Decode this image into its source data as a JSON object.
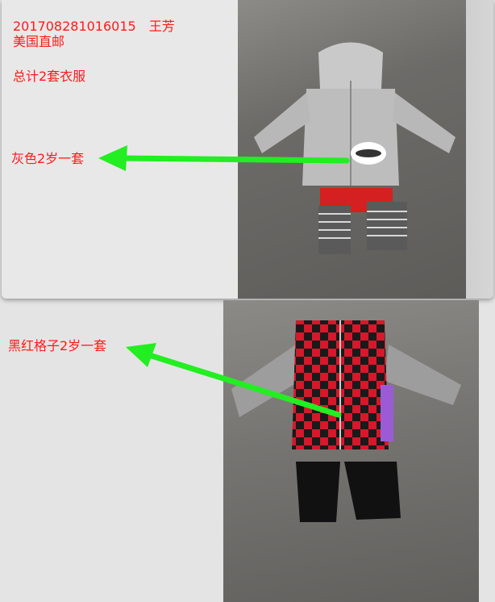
{
  "top_panel": {
    "order_line": "201708281016015　王芳",
    "shipping": "美国直邮",
    "total": "总计2套衣服",
    "item_label": "灰色2岁一套"
  },
  "bottom_panel": {
    "item_label": "黑红格子2岁一套"
  },
  "colors": {
    "annotation_text": "#ff1a1a",
    "arrow": "#22ee22",
    "panel_background": "#e8e8e8",
    "floor": "#6d6b68"
  }
}
